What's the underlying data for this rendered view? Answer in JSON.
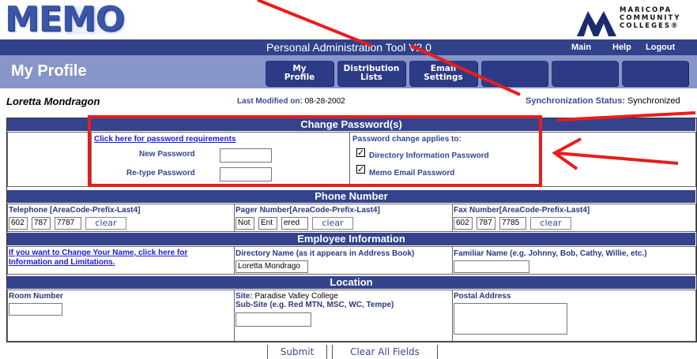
{
  "header": {
    "logo": "MEMO",
    "app_title": "Personal Administration Tool V2.0",
    "nav": [
      "Main",
      "Help",
      "Logout"
    ],
    "org_logo_lines": [
      "MARICOPA",
      "COMMUNITY",
      "COLLEGES®"
    ],
    "brand_color": "#31418a"
  },
  "subheader": {
    "page_title": "My Profile",
    "tabs": [
      {
        "line1": "My",
        "line2": "Profile"
      },
      {
        "line1": "Distribution",
        "line2": "Lists"
      },
      {
        "line1": "Email",
        "line2": "Settings"
      }
    ]
  },
  "info": {
    "user_name": "Loretta Mondragon",
    "last_modified_label": "Last Modified on:",
    "last_modified_value": "08-28-2002",
    "sync_label": "Synchronization Status:",
    "sync_value": "Synchronized"
  },
  "password": {
    "section_title": "Change Password(s)",
    "requirements_link": "Click here for password requirements",
    "new_password_label": "New Password",
    "retype_password_label": "Re-type Password",
    "new_password_value": "",
    "retype_password_value": "",
    "applies_label": "Password change applies to:",
    "options": [
      {
        "label": "Directory Information Password",
        "checked": true
      },
      {
        "label": "Memo Email Password",
        "checked": true
      }
    ],
    "check_mark": "✓"
  },
  "phone": {
    "section_title": "Phone Number",
    "telephone_label": "Telephone [AreaCode-Prefix-Last4]",
    "telephone_values": [
      "602",
      "787",
      "7787"
    ],
    "pager_label": "Pager Number[AreaCode-Prefix-Last4]",
    "pager_values": [
      "Not",
      "Ent",
      "ered"
    ],
    "fax_label": "Fax Number[AreaCode-Prefix-Last4]",
    "fax_values": [
      "602",
      "787",
      "7785"
    ],
    "clear_label": "clear"
  },
  "employee": {
    "section_title": "Employee Information",
    "change_name_link": "If you want to Change Your Name, click here for Information and Limitations.",
    "directory_name_label": "Directory Name (as it appears in Address Book)",
    "directory_name_value": "Loretta Mondrago",
    "familiar_name_label": "Familiar Name (e.g. Johnny, Bob, Cathy, Willie, etc.)",
    "familiar_name_value": ""
  },
  "location": {
    "section_title": "Location",
    "room_label": "Room Number",
    "room_value": "",
    "site_label": "Site:",
    "site_value": "Paradise Valley College",
    "subsite_label": "Sub-Site (e.g. Red MTN, MSC, WC, Tempe)",
    "subsite_value": "",
    "postal_label": "Postal Address",
    "postal_value": ""
  },
  "actions": {
    "submit": "Submit",
    "clear_all": "Clear All Fields"
  },
  "annotation_color": "#ea1c1c"
}
